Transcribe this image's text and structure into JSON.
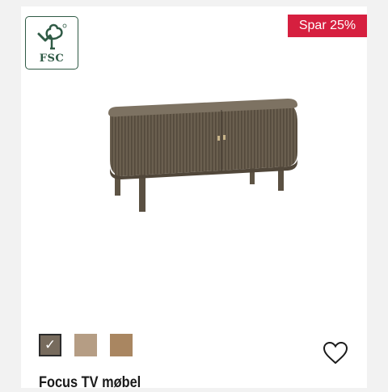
{
  "certification": {
    "label": "FSC",
    "icon": "fsc-tree-icon",
    "color": "#2f5a45"
  },
  "badge": {
    "label": "Spar 25%",
    "color": "#d61f3f"
  },
  "product": {
    "image_icon": "tv-cabinet-image",
    "title": "Focus TV møbel"
  },
  "swatches": [
    {
      "color": "#776b5d",
      "selected": true,
      "check_icon": "✓"
    },
    {
      "color": "#b59d84",
      "selected": false
    },
    {
      "color": "#a98661",
      "selected": false
    }
  ],
  "wishlist": {
    "icon": "heart-icon"
  }
}
